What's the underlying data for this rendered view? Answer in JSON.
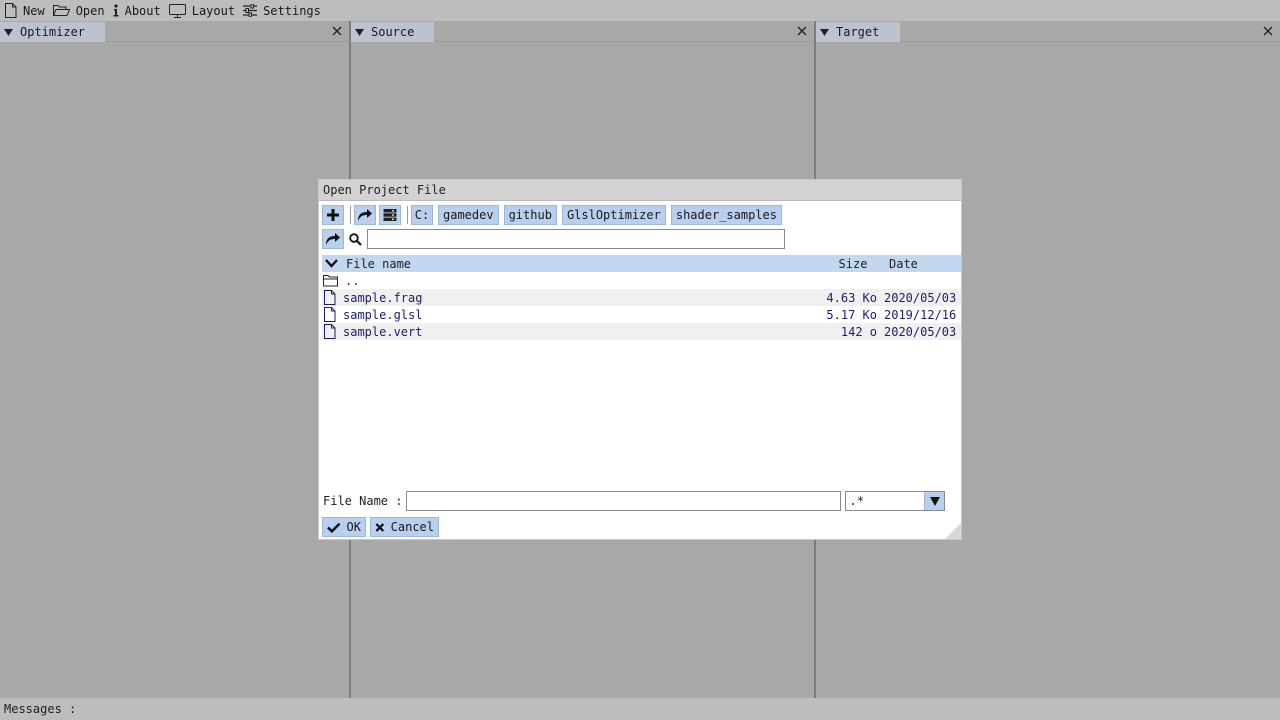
{
  "menubar": {
    "items": [
      {
        "label": "New",
        "icon": "file-icon"
      },
      {
        "label": "Open",
        "icon": "folder-open-icon"
      },
      {
        "label": "About",
        "icon": "info-icon"
      },
      {
        "label": "Layout",
        "icon": "monitor-icon"
      },
      {
        "label": "Settings",
        "icon": "sliders-icon"
      }
    ]
  },
  "panes": [
    {
      "title": "Optimizer"
    },
    {
      "title": "Source"
    },
    {
      "title": "Target"
    }
  ],
  "dialog": {
    "title": "Open Project File",
    "toolbar": {
      "add_icon": "plus-icon",
      "edit_path_icon": "share-arrow-icon",
      "drives_icon": "drives-icon"
    },
    "breadcrumbs": [
      "C:",
      "gamedev",
      "github",
      "GlslOptimizer",
      "shader_samples"
    ],
    "search": {
      "value": "",
      "placeholder": ""
    },
    "table": {
      "columns": {
        "name": "File name",
        "size": "Size",
        "date": "Date"
      },
      "rows": [
        {
          "type": "dir",
          "name": "..",
          "size": "",
          "date": ""
        },
        {
          "type": "file",
          "name": "sample.frag",
          "size": "4.63 Ko",
          "date": "2020/05/03"
        },
        {
          "type": "file",
          "name": "sample.glsl",
          "size": "5.17 Ko",
          "date": "2019/12/16"
        },
        {
          "type": "file",
          "name": "sample.vert",
          "size": "142 o",
          "date": "2020/05/03"
        }
      ]
    },
    "file_name_label": "File Name :",
    "file_name_value": "",
    "filter_value": ".*",
    "ok_label": "OK",
    "cancel_label": "Cancel"
  },
  "status": {
    "label": "Messages :"
  },
  "colors": {
    "background": "#a8a8a8",
    "menubar": "#bdbdbd",
    "accent_button": "#b8cff0",
    "table_header": "#c4d7f0",
    "file_text": "#1d1d6e"
  }
}
